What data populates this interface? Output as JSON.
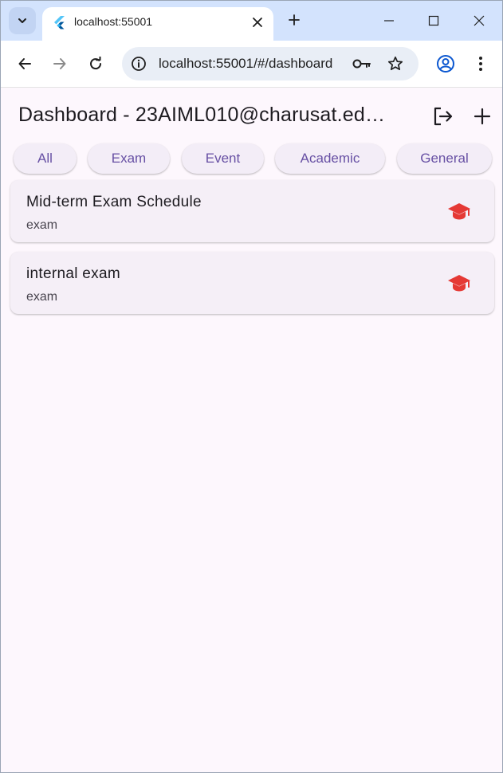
{
  "browser": {
    "tab_title": "localhost:55001",
    "url": "localhost:55001/#/dashboard",
    "icons": [
      "tab-search-icon",
      "flutter-favicon-icon",
      "close-icon",
      "plus-icon",
      "minimize-icon",
      "maximize-icon",
      "close-window-icon",
      "back-icon",
      "forward-icon",
      "reload-icon",
      "info-icon",
      "key-icon",
      "star-icon",
      "profile-icon",
      "more-vert-icon"
    ]
  },
  "appbar": {
    "title": "Dashboard - 23AIML010@charusat.ed…",
    "icons": [
      "logout-icon",
      "add-icon"
    ]
  },
  "filters": [
    "All",
    "Exam",
    "Event",
    "Academic",
    "General"
  ],
  "items": [
    {
      "title": "Mid-term Exam Schedule",
      "category": "exam",
      "icon": "school-icon"
    },
    {
      "title": "internal exam",
      "category": "exam",
      "icon": "school-icon"
    }
  ],
  "colors": {
    "accent": "#6750a4",
    "icon_red": "#e53935",
    "background": "#fdf7fd",
    "chrome_tabstrip": "#d3e3fd"
  }
}
